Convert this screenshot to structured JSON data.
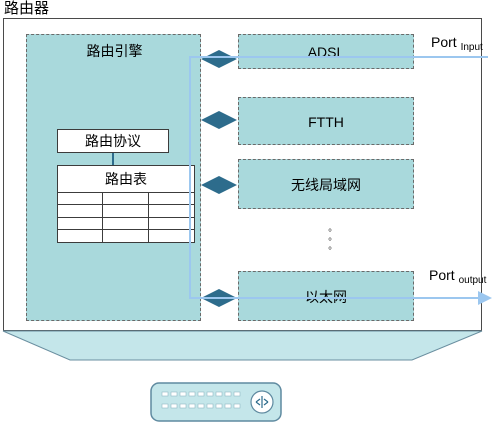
{
  "router": {
    "title": "路由器"
  },
  "engine": {
    "label": "路由引擎",
    "protocol_label": "路由协议",
    "table_label": "路由表",
    "table_rows": 4,
    "table_cols": 3
  },
  "interfaces": [
    {
      "label": "ADSL"
    },
    {
      "label": "FTTH"
    },
    {
      "label": "无线局域网"
    },
    {
      "label": "以太网"
    }
  ],
  "ports": {
    "input": {
      "label": "Port",
      "sub": "Input"
    },
    "output": {
      "label": "Port",
      "sub": "output"
    }
  },
  "colors": {
    "box_fill": "#a9d9dc",
    "arrow": "#2d6c8c",
    "port_line": "#9cc7ef",
    "device_fill": "#c4e6ea"
  },
  "device": {
    "icon": "router-device-icon"
  }
}
